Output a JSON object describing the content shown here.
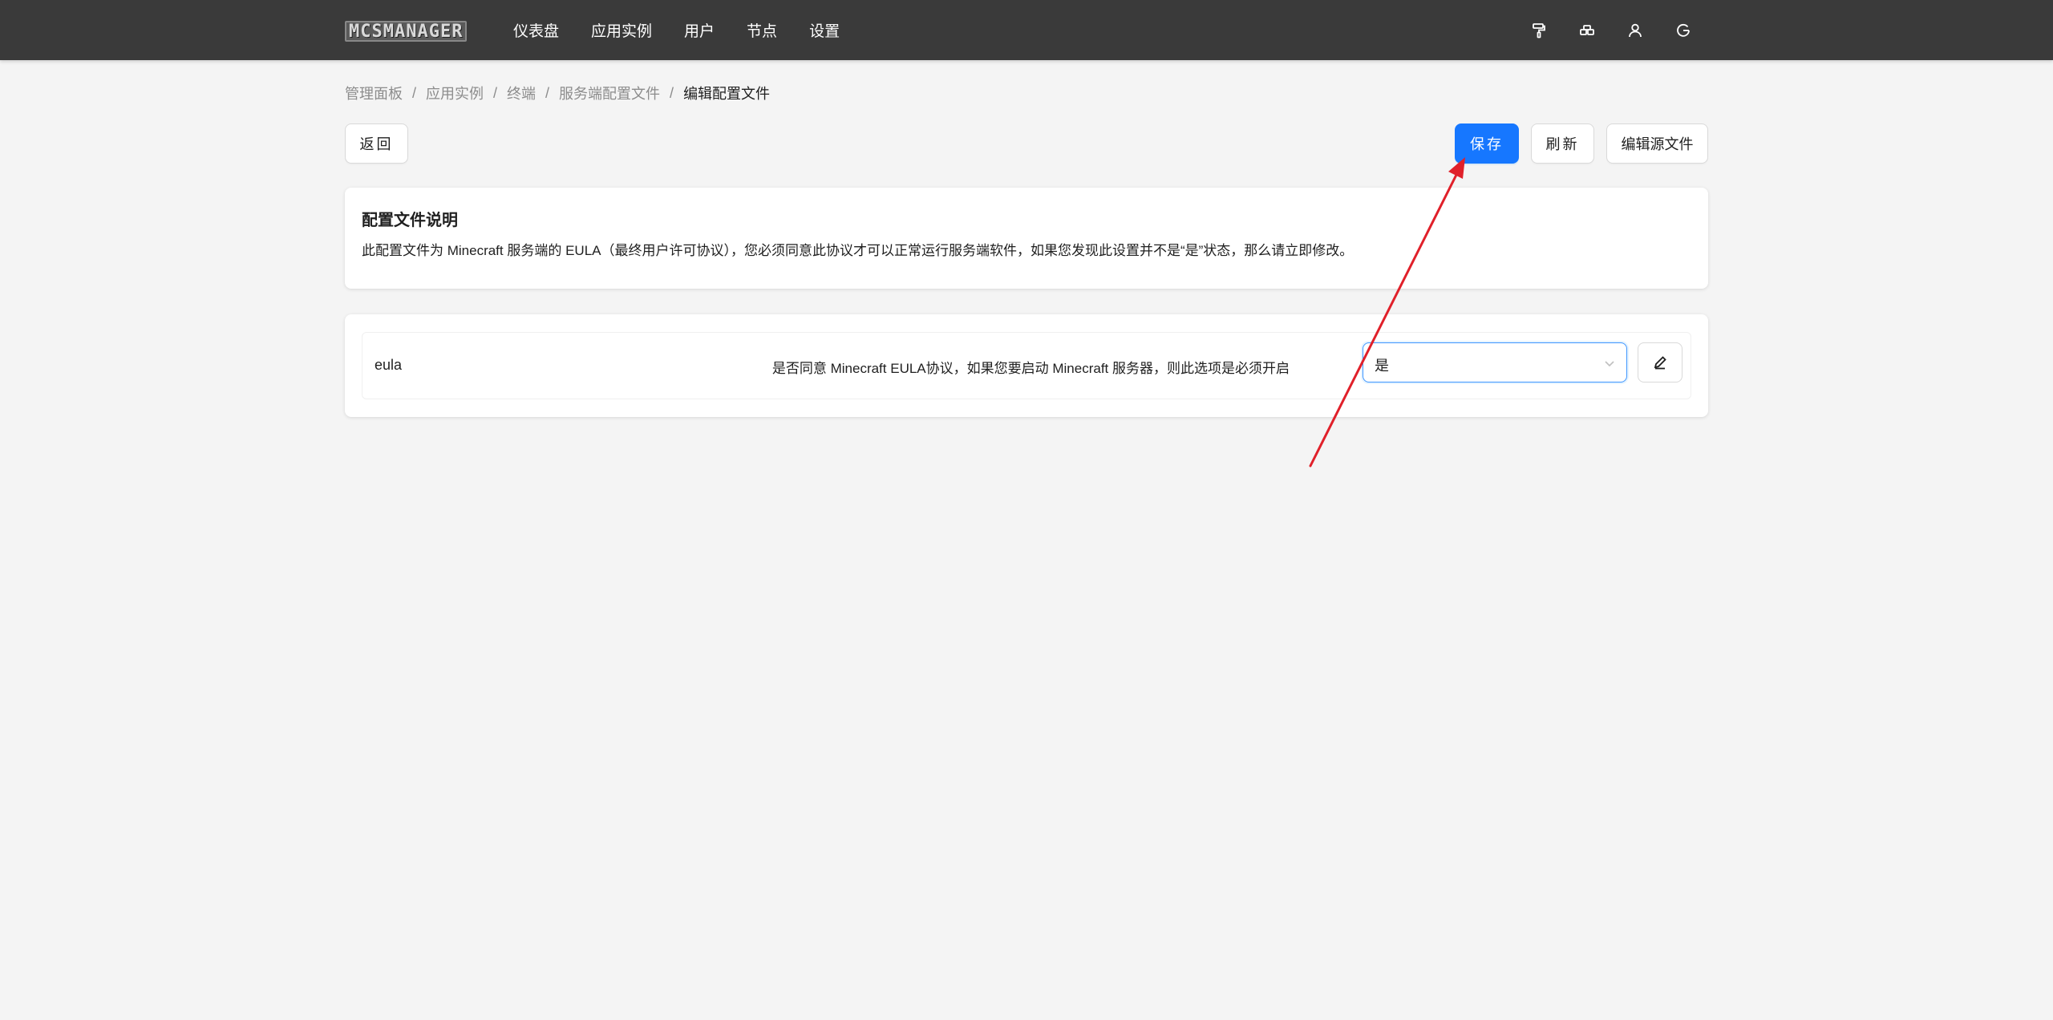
{
  "app": {
    "logo_text": "MCSMANAGER"
  },
  "nav": {
    "items": [
      {
        "label": "仪表盘"
      },
      {
        "label": "应用实例"
      },
      {
        "label": "用户"
      },
      {
        "label": "节点"
      },
      {
        "label": "设置"
      }
    ],
    "icons": [
      "paint-roller-icon",
      "layout-icon",
      "user-icon",
      "logout-icon"
    ]
  },
  "breadcrumb": {
    "items": [
      "管理面板",
      "应用实例",
      "终端",
      "服务端配置文件"
    ],
    "current": "编辑配置文件",
    "separator": "/"
  },
  "toolbar": {
    "back_label": "返回",
    "save_label": "保存",
    "refresh_label": "刷新",
    "edit_source_label": "编辑源文件"
  },
  "description_card": {
    "title": "配置文件说明",
    "text": "此配置文件为 Minecraft 服务端的 EULA（最终用户许可协议），您必须同意此协议才可以正常运行服务端软件，如果您发现此设置并不是“是”状态，那么请立即修改。"
  },
  "config": {
    "rows": [
      {
        "key": "eula",
        "description": "是否同意 Minecraft EULA协议，如果您要启动 Minecraft 服务器，则此选项是必须开启",
        "value": "是"
      }
    ]
  },
  "colors": {
    "navbar_bg": "#3a3a3a",
    "primary": "#1677ff",
    "page_bg": "#f4f4f4",
    "annotation_arrow": "#e0202a"
  }
}
